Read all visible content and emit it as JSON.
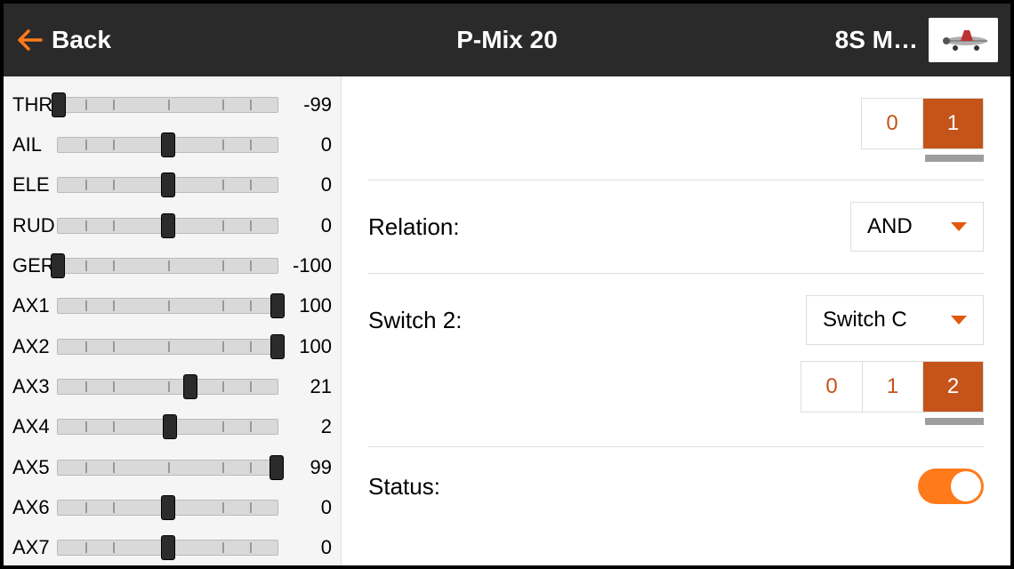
{
  "header": {
    "back_label": "Back",
    "title": "P-Mix 20",
    "model_label": "8S M…"
  },
  "channels": [
    {
      "label": "THR",
      "value": -99
    },
    {
      "label": "AIL",
      "value": 0
    },
    {
      "label": "ELE",
      "value": 0
    },
    {
      "label": "RUD",
      "value": 0
    },
    {
      "label": "GER",
      "value": -100
    },
    {
      "label": "AX1",
      "value": 100
    },
    {
      "label": "AX2",
      "value": 100
    },
    {
      "label": "AX3",
      "value": 21
    },
    {
      "label": "AX4",
      "value": 2
    },
    {
      "label": "AX5",
      "value": 99
    },
    {
      "label": "AX6",
      "value": 0
    },
    {
      "label": "AX7",
      "value": 0
    }
  ],
  "switch1": {
    "options": [
      "0",
      "1"
    ],
    "selected": 1
  },
  "relation": {
    "label": "Relation:",
    "value": "AND"
  },
  "switch2": {
    "label": "Switch 2:",
    "value": "Switch C",
    "options": [
      "0",
      "1",
      "2"
    ],
    "selected": 2
  },
  "status": {
    "label": "Status:",
    "on": true
  },
  "colors": {
    "accent": "#c4541a",
    "accent_bright": "#ff7a1a"
  }
}
